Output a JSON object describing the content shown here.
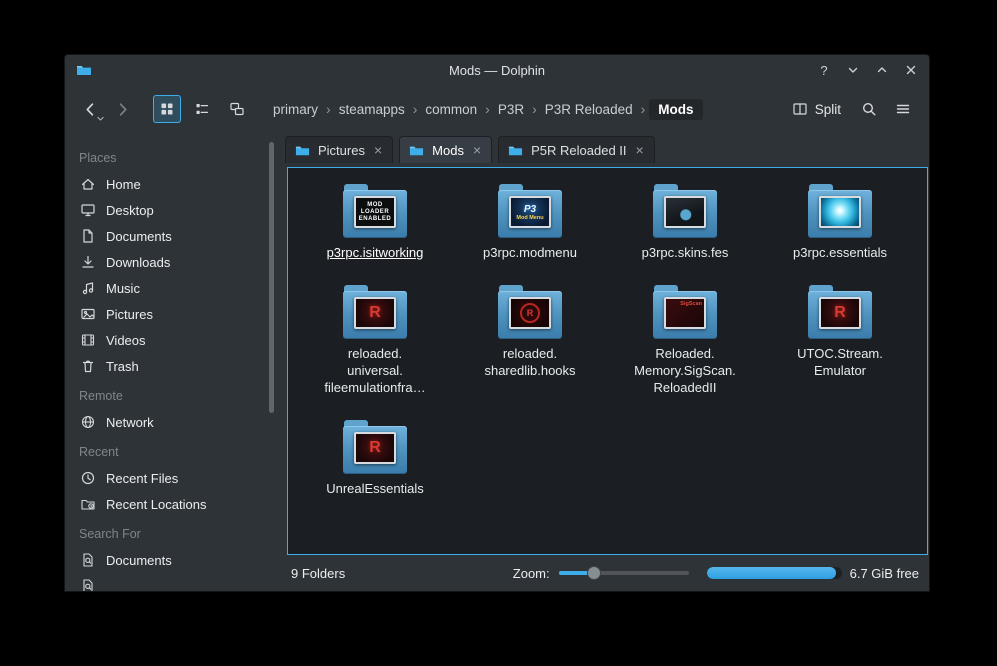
{
  "titlebar": {
    "title": "Mods — Dolphin",
    "help_label": "?"
  },
  "toolbar": {
    "breadcrumb": [
      "primary",
      "steamapps",
      "common",
      "P3R",
      "P3R Reloaded",
      "Mods"
    ],
    "crumb_separator": "›",
    "split_label": "Split"
  },
  "tabs": [
    {
      "label": "Pictures",
      "close": "×"
    },
    {
      "label": "Mods",
      "close": "×",
      "active": true
    },
    {
      "label": "P5R Reloaded II",
      "close": "×"
    }
  ],
  "sidebar": {
    "sections": [
      {
        "header": "Places",
        "items": [
          {
            "label": "Home"
          },
          {
            "label": "Desktop"
          },
          {
            "label": "Documents"
          },
          {
            "label": "Downloads"
          },
          {
            "label": "Music"
          },
          {
            "label": "Pictures"
          },
          {
            "label": "Videos"
          },
          {
            "label": "Trash"
          }
        ]
      },
      {
        "header": "Remote",
        "items": [
          {
            "label": "Network"
          }
        ]
      },
      {
        "header": "Recent",
        "items": [
          {
            "label": "Recent Files"
          },
          {
            "label": "Recent Locations"
          }
        ]
      },
      {
        "header": "Search For",
        "items": [
          {
            "label": "Documents"
          }
        ]
      }
    ]
  },
  "files": {
    "items": [
      {
        "label": "p3rpc.isitworking",
        "selected": true,
        "thumb_text": "MOD\nLOADER\nENABLED"
      },
      {
        "label": "p3rpc.modmenu",
        "thumb_top": "P3",
        "thumb_bottom": "Mod Menu"
      },
      {
        "label": "p3rpc.skins.fes"
      },
      {
        "label": "p3rpc.essentials"
      },
      {
        "label": "reloaded.\nuniversal.\nfileemulationfra…",
        "thumb_text": "R"
      },
      {
        "label": "reloaded.\nsharedlib.hooks",
        "thumb_text": "R"
      },
      {
        "label": "Reloaded.\nMemory.SigScan.\nReloadedII",
        "thumb_text": "SigScan"
      },
      {
        "label": "UTOC.Stream.\nEmulator",
        "thumb_text": "R"
      },
      {
        "label": "UnrealEssentials",
        "thumb_text": "R"
      }
    ]
  },
  "statusbar": {
    "folders_label": "9 Folders",
    "zoom_label": "Zoom:",
    "free_label": "6.7 GiB free",
    "zoom_percent": 27,
    "disk_percent": 96
  },
  "colors": {
    "accent": "#3daee9",
    "folder_blue": "#4f93bf",
    "view_bg": "#1b1f23"
  }
}
